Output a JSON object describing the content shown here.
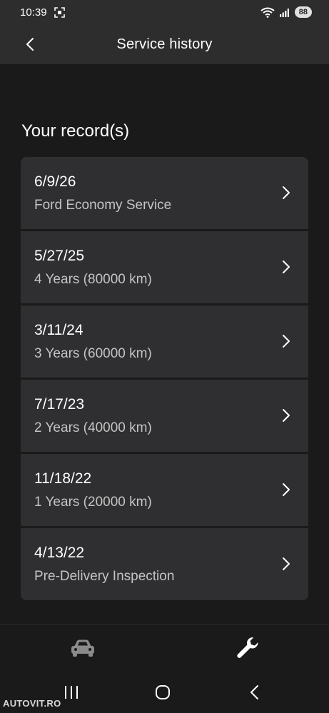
{
  "status": {
    "time": "10:39",
    "battery": "88"
  },
  "header": {
    "title": "Service history"
  },
  "section": {
    "title": "Your record(s)"
  },
  "records": [
    {
      "date": "6/9/26",
      "description": "Ford Economy Service"
    },
    {
      "date": "5/27/25",
      "description": "4 Years (80000 km)"
    },
    {
      "date": "3/11/24",
      "description": "3 Years (60000 km)"
    },
    {
      "date": "7/17/23",
      "description": "2 Years (40000 km)"
    },
    {
      "date": "11/18/22",
      "description": "1 Years (20000 km)"
    },
    {
      "date": "4/13/22",
      "description": "Pre-Delivery Inspection"
    }
  ],
  "bottom_nav": {
    "items": [
      {
        "icon": "car-icon",
        "active": false
      },
      {
        "icon": "wrench-icon",
        "active": true
      }
    ]
  },
  "watermark": "AUTOVIT.RO",
  "colors": {
    "background": "#1a1a1a",
    "bar": "#2d2d2d",
    "card": "#2f2e30",
    "secondary_text": "#c4c4c4"
  }
}
